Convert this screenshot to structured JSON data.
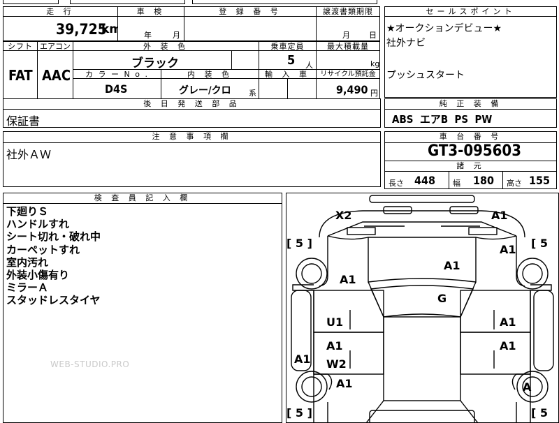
{
  "top_row": {
    "mileage_header": "走 行",
    "inspection_header": "車 検",
    "registration_header": "登 録 番 号",
    "transfer_header": "譲渡書類期限",
    "sellpoint_header": "セールスポイント"
  },
  "mileage": {
    "value": "39,725",
    "unit": "km"
  },
  "inspection": {
    "year_label": "年",
    "month_label": "月"
  },
  "transfer": {
    "month_label": "月",
    "day_label": "日"
  },
  "row2": {
    "shift_header": "シフト",
    "aircon_header": "エアコン",
    "exterior_header": "外 装 色",
    "capacity_header": "乗車定員",
    "maxload_header": "最大積載量",
    "shift": "FAT",
    "aircon": "AAC",
    "exterior_color": "ブラック",
    "capacity": "5",
    "capacity_unit": "人",
    "maxload_unit": "kg"
  },
  "row3": {
    "color_no_header": "カ ラ ー  N o .",
    "interior_header": "内 装 色",
    "import_header": "輸 入 車",
    "recycle_header": "リサイクル預託金",
    "color_no": "D4S",
    "interior_color": "グレー/クロ",
    "interior_suffix": "系",
    "recycle_fee": "9,490",
    "recycle_unit": "円"
  },
  "sales_points": {
    "line1": "★オークションデビュー★",
    "line2": "社外ナビ",
    "line3": "プッシュスタート"
  },
  "later_parts": {
    "header": "後 日 発 送 部 品",
    "value": "保証書"
  },
  "equipment": {
    "header": "純 正 装 備",
    "value": "ABS  エアB  PS  PW"
  },
  "notes": {
    "header": "注 意 事 項 欄",
    "value": "社外ＡＷ"
  },
  "chassis": {
    "header": "車 台 番 号",
    "value": "GT3-095603"
  },
  "specs": {
    "header": "諸 元",
    "length_label": "長さ",
    "length": "448",
    "width_label": "幅",
    "width": "180",
    "height_label": "高さ",
    "height": "155"
  },
  "inspector": {
    "header": "検 査 員 記 入 欄",
    "notes": [
      "下廻りＳ",
      "ハンドルすれ",
      "シート切れ・破れ中",
      "カーペットすれ",
      "室内汚れ",
      "外装小傷有り",
      "ミラーＡ",
      "スタッドレスタイヤ"
    ]
  },
  "watermark": "WEB-STUDIO.PRO",
  "diagram": {
    "tires": [
      "[ 5 ]",
      "[ 5",
      "[ 5 ]",
      "[ 5"
    ],
    "damage": {
      "front_left_corner": "X2",
      "front_right_corner": "A1",
      "right_front_fender": "A1",
      "hood_right": "A1",
      "left_front_fender": "A1",
      "windshield": "G",
      "left_front_door": "U1",
      "right_front_door": "A1",
      "left_rear_door_a": "A1",
      "right_rear_door": "A1",
      "left_rear_door_w": "W2",
      "left_sill": "A1",
      "left_rear_fender": "A1",
      "right_rear_wheel": "A"
    }
  }
}
